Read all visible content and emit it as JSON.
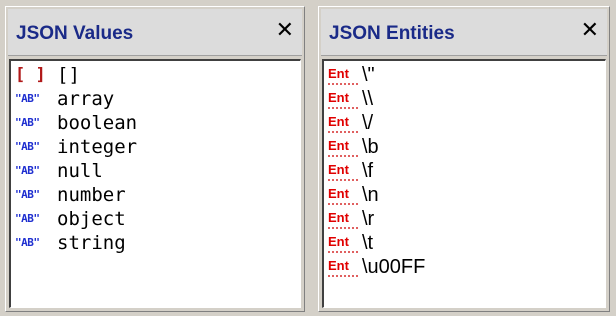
{
  "values_panel": {
    "title": "JSON Values",
    "close_glyph": "✕",
    "items": [
      {
        "icon": "array-bracket-icon",
        "glyph": "[ ]",
        "label": "[]"
      },
      {
        "icon": "string-ab-icon",
        "glyph": "\"AB\"",
        "label": "array"
      },
      {
        "icon": "string-ab-icon",
        "glyph": "\"AB\"",
        "label": "boolean"
      },
      {
        "icon": "string-ab-icon",
        "glyph": "\"AB\"",
        "label": "integer"
      },
      {
        "icon": "string-ab-icon",
        "glyph": "\"AB\"",
        "label": "null"
      },
      {
        "icon": "string-ab-icon",
        "glyph": "\"AB\"",
        "label": "number"
      },
      {
        "icon": "string-ab-icon",
        "glyph": "\"AB\"",
        "label": "object"
      },
      {
        "icon": "string-ab-icon",
        "glyph": "\"AB\"",
        "label": "string"
      }
    ]
  },
  "entities_panel": {
    "title": "JSON Entities",
    "close_glyph": "✕",
    "items": [
      {
        "icon": "entity-icon",
        "glyph": "Ent",
        "label": "\\\""
      },
      {
        "icon": "entity-icon",
        "glyph": "Ent",
        "label": "\\\\"
      },
      {
        "icon": "entity-icon",
        "glyph": "Ent",
        "label": "\\/"
      },
      {
        "icon": "entity-icon",
        "glyph": "Ent",
        "label": "\\b"
      },
      {
        "icon": "entity-icon",
        "glyph": "Ent",
        "label": "\\f"
      },
      {
        "icon": "entity-icon",
        "glyph": "Ent",
        "label": "\\n"
      },
      {
        "icon": "entity-icon",
        "glyph": "Ent",
        "label": "\\r"
      },
      {
        "icon": "entity-icon",
        "glyph": "Ent",
        "label": "\\t"
      },
      {
        "icon": "entity-icon",
        "glyph": "Ent",
        "label": "\\u00FF"
      }
    ]
  },
  "colors": {
    "title": "#1a2a88",
    "ab_icon": "#1f2fd0",
    "bracket_icon": "#b01818",
    "ent_icon": "#e00000"
  }
}
